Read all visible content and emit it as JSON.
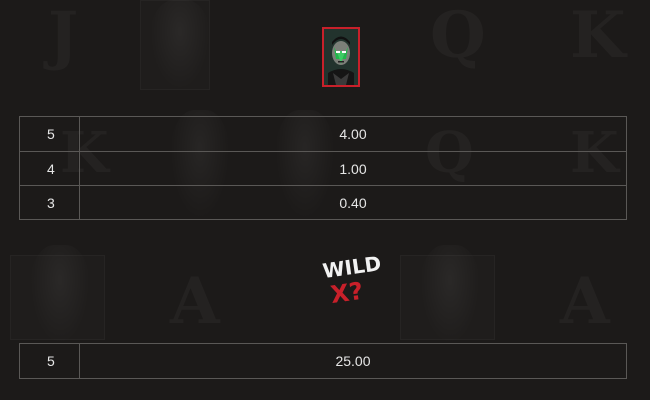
{
  "symbols": [
    {
      "name": "green-masked-villain",
      "frame_color": "#c8202a",
      "paytable": [
        {
          "count": "5",
          "payout": "4.00"
        },
        {
          "count": "4",
          "payout": "1.00"
        },
        {
          "count": "3",
          "payout": "0.40"
        }
      ]
    },
    {
      "name": "wild",
      "logo_text": "WILD",
      "logo_mark": "X?",
      "mark_color": "#c8202a",
      "paytable": [
        {
          "count": "5",
          "payout": "25.00"
        }
      ]
    }
  ],
  "colors": {
    "background": "#1c1a19",
    "table_border": "#5a5856",
    "text": "#e6e6e6"
  }
}
